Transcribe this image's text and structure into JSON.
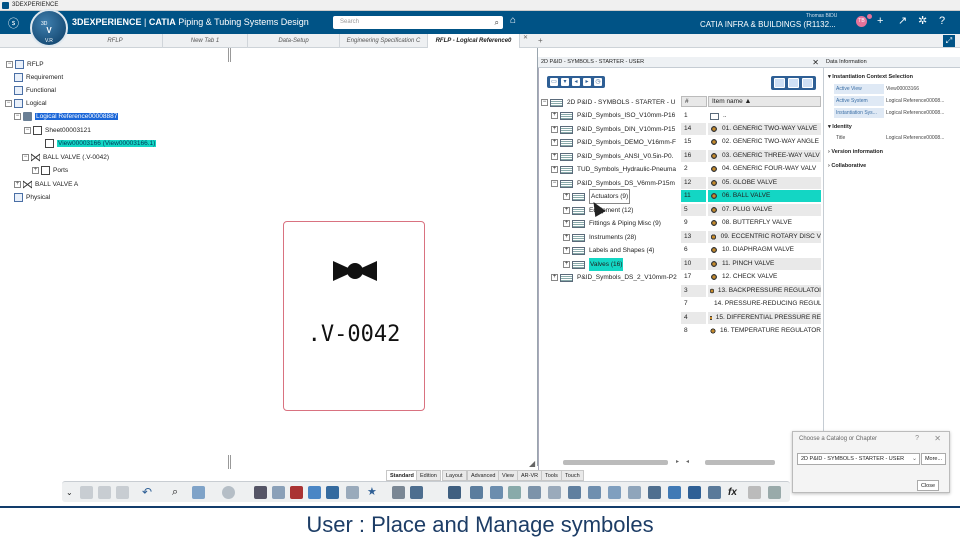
{
  "window_title": "3DEXPERIENCE",
  "brand": {
    "prefix": "3DEXPERIENCE",
    "sep": " | ",
    "app": "CATIA",
    "module": " Piping & Tubing Systems Design"
  },
  "compass": {
    "label": "V",
    "sub": "3D",
    "version": "V.R"
  },
  "search": {
    "placeholder": "Search"
  },
  "user": {
    "name": "Thomas BIDU",
    "company": "CATIA INFRA & BUILDINGS (R1132...",
    "initials": "TB"
  },
  "tabs": [
    "RFLP",
    "New Tab 1",
    "Data-Setup",
    "Engineering Specification C",
    "RFLP - Logical Reference0"
  ],
  "tree": {
    "root": "RFLP",
    "requirement": "Requirement",
    "functional": "Functional",
    "logical": "Logical",
    "logical_ref": "Logical Reference00008887",
    "sheet": "Sheet00003121",
    "view": "View00003166 (View00003166.1)",
    "ball_valve": "BALL VALVE (.V-0042)",
    "ports": "Ports",
    "ball_valve_a": "BALL VALVE A",
    "physical": "Physical"
  },
  "symbol_label": ".V-0042",
  "catalog": {
    "title": "2D P&ID - SYMBOLS - STARTER - USER",
    "root": "2D P&ID - SYMBOLS - STARTER - U",
    "items": [
      "P&ID_Symbols_ISO_V10mm-P16",
      "P&ID_Symbols_DIN_V10mm-P15",
      "P&ID_Symbols_DEMO_V16mm-F",
      "P&ID_Symbols_ANSI_V0.5in-P0.",
      "TUD_Symbols_Hydraulic-Pneuma",
      "P&ID_Symbols_DS_V6mm-P15m"
    ],
    "chapters": [
      "Actuators (9)",
      "Equipment (12)",
      "Fittings & Piping Misc (9)",
      "Instruments (28)",
      "Labels and Shapes (4)",
      "Valves (16)"
    ],
    "last_item": "P&ID_Symbols_DS_2_V10mm-P2"
  },
  "list": {
    "col_num": "#",
    "col_name": "Item name",
    "rows": [
      {
        "num": "1",
        "name": ".."
      },
      {
        "num": "14",
        "name": "01. GENERIC TWO-WAY VALVE"
      },
      {
        "num": "15",
        "name": "02. GENERIC TWO-WAY ANGLE"
      },
      {
        "num": "16",
        "name": "03. GENERIC THREE-WAY VALV"
      },
      {
        "num": "2",
        "name": "04. GENERIC FOUR-WAY VALV"
      },
      {
        "num": "12",
        "name": "05. GLOBE VALVE"
      },
      {
        "num": "11",
        "name": "06. BALL VALVE"
      },
      {
        "num": "5",
        "name": "07. PLUG VALVE"
      },
      {
        "num": "9",
        "name": "08. BUTTERFLY VALVE"
      },
      {
        "num": "13",
        "name": "09. ECCENTRIC ROTARY DISC V"
      },
      {
        "num": "6",
        "name": "10. DIAPHRAGM VALVE"
      },
      {
        "num": "10",
        "name": "11. PINCH VALVE"
      },
      {
        "num": "17",
        "name": "12. CHECK VALVE"
      },
      {
        "num": "3",
        "name": "13. BACKPRESSURE REGULATOI"
      },
      {
        "num": "7",
        "name": "14. PRESSURE-REDUCING REGUL"
      },
      {
        "num": "4",
        "name": "15. DIFFERENTIAL PRESSURE RE"
      },
      {
        "num": "8",
        "name": "16. TEMPERATURE REGULATOR"
      }
    ]
  },
  "data_info": {
    "title": "Data Information",
    "section1": "Instantiation Context Selection",
    "active_view_label": "Active View",
    "active_view_value": "View00003166",
    "active_system_label": "Active System",
    "active_system_value": "Logical Reference00008...",
    "inst_sys_label": "Instantiation Sys...",
    "inst_sys_value": "Logical Reference00008...",
    "section2": "Identity",
    "title_label": "Title",
    "title_value": "Logical Reference00008...",
    "section3": "Version information",
    "section4": "Collaborative"
  },
  "chooser": {
    "title": "Choose a Catalog or Chapter",
    "help": "?",
    "selected": "2D P&ID - SYMBOLS - STARTER - USER",
    "more": "More...",
    "close": "Close"
  },
  "section_tabs": [
    "Standard",
    "Edition",
    "Layout",
    "Advanced",
    "View",
    "AR-VR",
    "Tools",
    "Touch"
  ],
  "banner": "User : Place and Manage symboles",
  "colors": {
    "header": "#005386",
    "highlight": "#13d6c4",
    "selection": "#1a66d8",
    "card_border": "#d97280"
  }
}
